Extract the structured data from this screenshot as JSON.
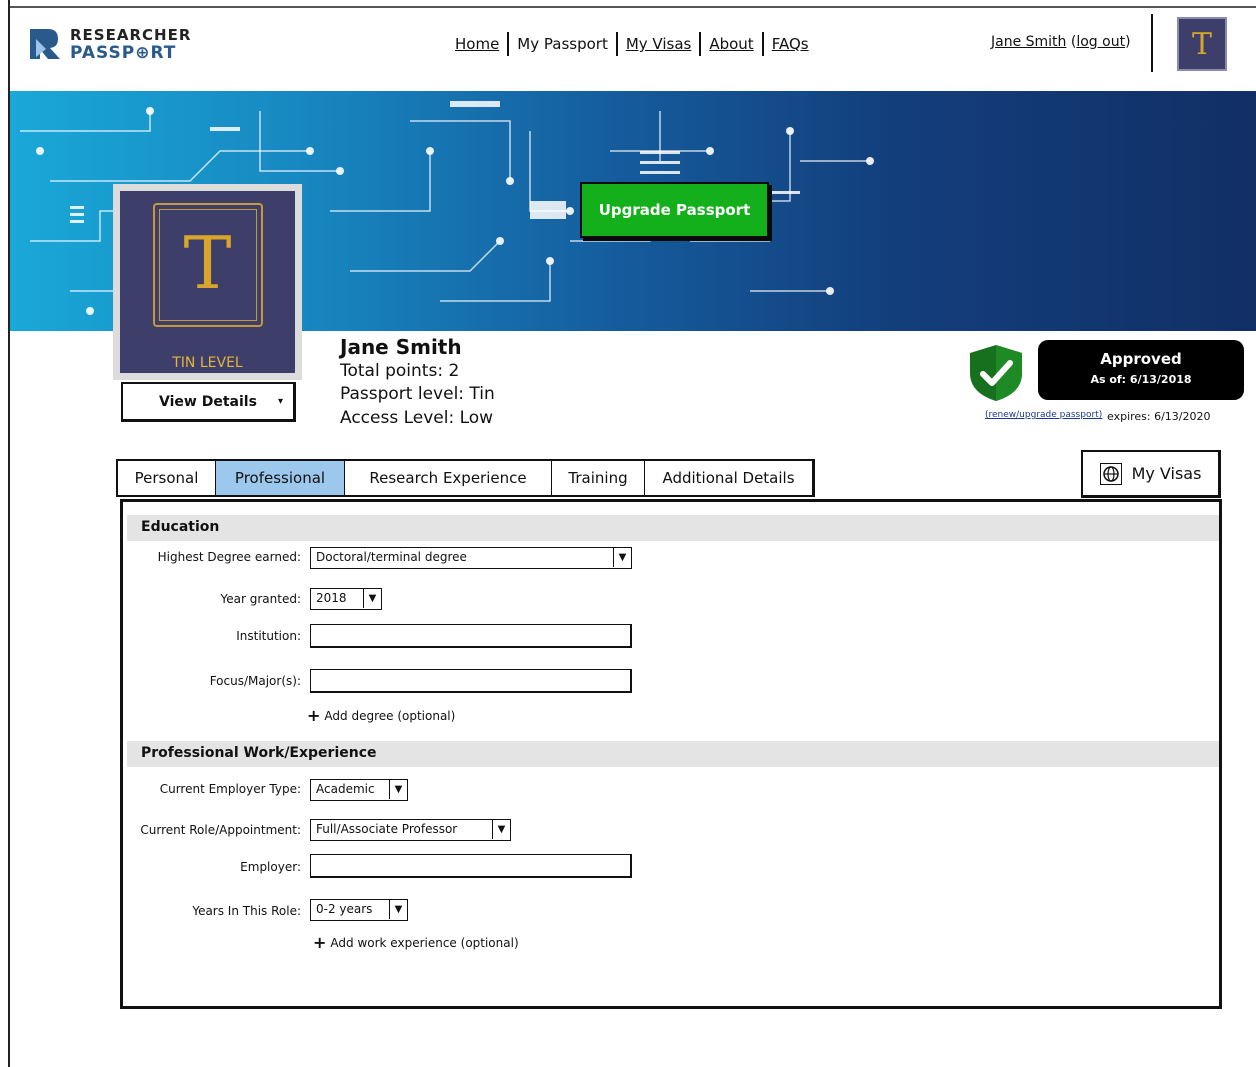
{
  "header": {
    "logo": {
      "line1": "RESEARCHER",
      "line2": "PASSP⊕RT"
    },
    "nav": [
      {
        "label": "Home",
        "link": true
      },
      {
        "label": "My Passport",
        "link": false
      },
      {
        "label": "My Visas",
        "link": true
      },
      {
        "label": "About",
        "link": true
      },
      {
        "label": "FAQs",
        "link": true
      }
    ],
    "user": {
      "name": "Jane Smith",
      "logout": "log out",
      "avatar_letter": "T"
    }
  },
  "banner": {
    "upgrade_label": "Upgrade Passport"
  },
  "profile": {
    "level_letter": "T",
    "level_label": "TIN LEVEL",
    "view_details": "View Details",
    "name": "Jane Smith",
    "total_points": "Total points: 2",
    "passport_level": "Passport level: Tin",
    "access_level": "Access Level: Low"
  },
  "status": {
    "approved": "Approved",
    "as_of": "As of: 6/13/2018",
    "renew_link": "(renew/upgrade passport)",
    "expires": "expires: 6/13/2020",
    "colors": {
      "shield": "#17701e",
      "approved_bg": "#000000"
    }
  },
  "tabs": [
    {
      "label": "Personal",
      "active": false
    },
    {
      "label": "Professional",
      "active": true
    },
    {
      "label": "Research Experience",
      "active": false
    },
    {
      "label": "Training",
      "active": false
    },
    {
      "label": "Additional Details",
      "active": false
    }
  ],
  "myvisas_label": "My Visas",
  "education": {
    "title": "Education",
    "highest_degree_label": "Highest Degree earned:",
    "highest_degree_value": "Doctoral/terminal degree",
    "year_label": "Year granted:",
    "year_value": "2018",
    "institution_label": "Institution:",
    "institution_value": "",
    "focus_label": "Focus/Major(s):",
    "focus_value": "",
    "add_degree": "Add degree (optional)"
  },
  "work": {
    "title": "Professional Work/Experience",
    "employer_type_label": "Current Employer Type:",
    "employer_type_value": "Academic",
    "role_label": "Current Role/Appointment:",
    "role_value": "Full/Associate Professor",
    "employer_label": "Employer:",
    "employer_value": "",
    "years_label": "Years In This Role:",
    "years_value": "0-2 years",
    "add_work": "Add work experience (optional)"
  }
}
